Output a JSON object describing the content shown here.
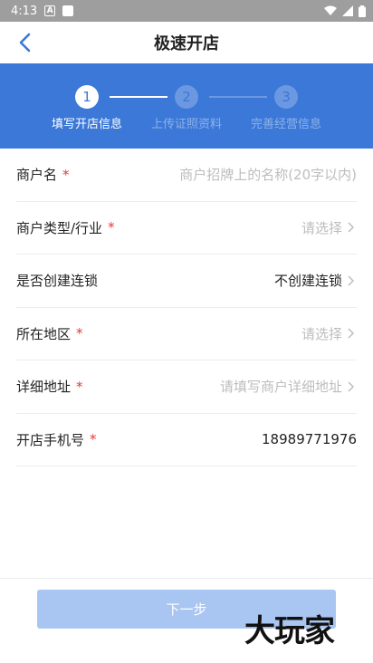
{
  "status_bar": {
    "time": "4:13",
    "a_icon": "A"
  },
  "header": {
    "title": "极速开店"
  },
  "stepper": {
    "steps": [
      {
        "num": "1",
        "label": "填写开店信息",
        "active": true
      },
      {
        "num": "2",
        "label": "上传证照资料",
        "active": false
      },
      {
        "num": "3",
        "label": "完善经营信息",
        "active": false
      }
    ]
  },
  "form": {
    "rows": [
      {
        "label": "商户名",
        "required": "*",
        "placeholder": "商户招牌上的名称(20字以内)"
      },
      {
        "label": "商户类型/行业",
        "required": "*",
        "placeholder": "请选择"
      },
      {
        "label": "是否创建连锁",
        "value": "不创建连锁"
      },
      {
        "label": "所在地区",
        "required": "*",
        "placeholder": "请选择"
      },
      {
        "label": "详细地址",
        "required": "*",
        "placeholder": "请填写商户详细地址"
      },
      {
        "label": "开店手机号",
        "required": "*",
        "value": "18989771976"
      }
    ]
  },
  "footer": {
    "next_label": "下一步",
    "watermark": "大玩家"
  },
  "colors": {
    "primary": "#3b78d8",
    "required": "#e53935",
    "button_disabled": "#a9c6f2"
  }
}
